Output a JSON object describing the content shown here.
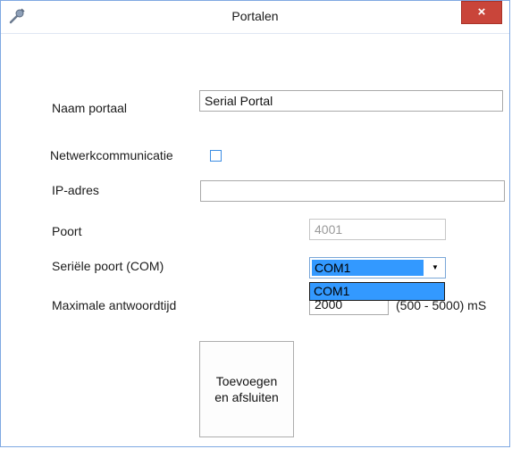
{
  "window": {
    "title": "Portalen",
    "close_label": "×"
  },
  "form": {
    "name": {
      "label": "Naam portaal",
      "value": "Serial Portal"
    },
    "network": {
      "label": "Netwerkcommunicatie",
      "checked": false
    },
    "ip": {
      "label": "IP-adres",
      "value": ""
    },
    "port": {
      "label": "Poort",
      "value": "4001"
    },
    "com": {
      "label": "Seriële poort (COM)",
      "selected": "COM1",
      "options": [
        "COM1"
      ]
    },
    "timeout": {
      "label": "Maximale antwoordtijd",
      "value": "2000",
      "range": "(500 - 5000) mS"
    }
  },
  "actions": {
    "submit_line1": "Toevoegen",
    "submit_line2": "en afsluiten"
  }
}
